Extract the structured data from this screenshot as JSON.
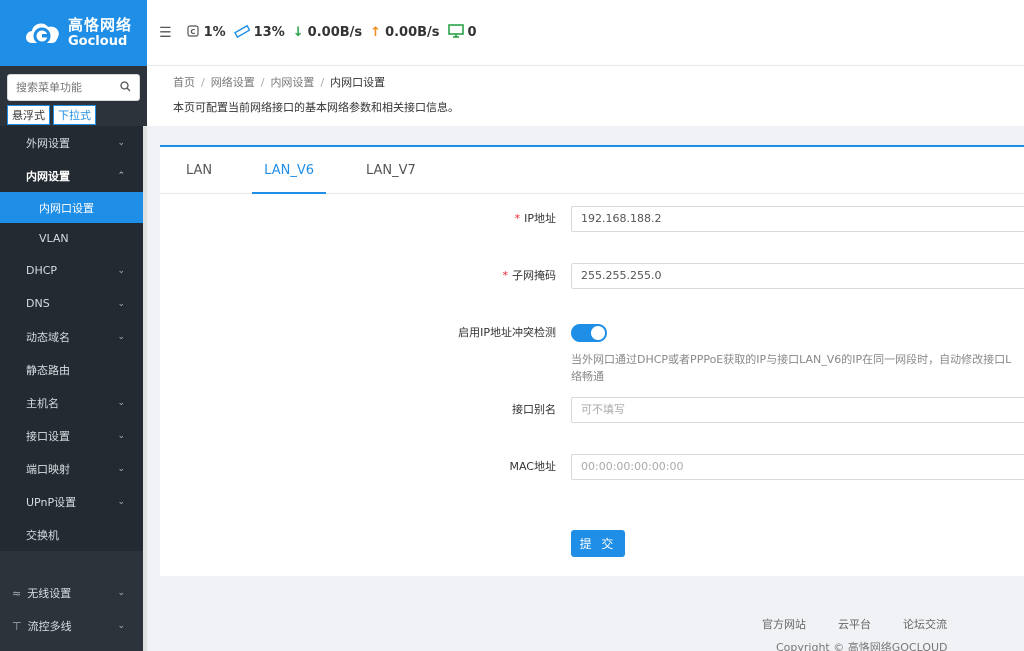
{
  "brand": {
    "name_cn": "高恪网络",
    "name_en": "Gocloud"
  },
  "topbar": {
    "cpu": "1%",
    "memory": "13%",
    "download": "0.00B/s",
    "upload": "0.00B/s",
    "devices": "0"
  },
  "sidebar": {
    "search_placeholder": "搜索菜单功能",
    "mode_buttons": [
      "悬浮式",
      "下拉式"
    ],
    "items": [
      {
        "label": "外网设置"
      },
      {
        "label": "内网设置"
      },
      {
        "label": "内网口设置"
      },
      {
        "label": "VLAN"
      },
      {
        "label": "DHCP"
      },
      {
        "label": "DNS"
      },
      {
        "label": "动态域名"
      },
      {
        "label": "静态路由"
      },
      {
        "label": "主机名"
      },
      {
        "label": "接口设置"
      },
      {
        "label": "端口映射"
      },
      {
        "label": "UPnP设置"
      },
      {
        "label": "交换机"
      }
    ],
    "bottom_items": [
      {
        "label": "无线设置"
      },
      {
        "label": "流控多线"
      }
    ]
  },
  "breadcrumb": [
    "首页",
    "网络设置",
    "内网设置",
    "内网口设置"
  ],
  "page_desc": "本页可配置当前网络接口的基本网络参数和相关接口信息。",
  "tabs": [
    "LAN",
    "LAN_V6",
    "LAN_V7"
  ],
  "form": {
    "ip_label": "IP地址",
    "ip_value": "192.168.188.2",
    "mask_label": "子网掩码",
    "mask_value": "255.255.255.0",
    "conflict_label": "启用IP地址冲突检测",
    "conflict_enabled": true,
    "conflict_hint_1": "当外网口通过DHCP或者PPPoE获取的IP与接口LAN_V6的IP在同一网段时，自动修改接口L",
    "conflict_hint_2": "络畅通",
    "alias_label": "接口别名",
    "alias_placeholder": "可不填写",
    "mac_label": "MAC地址",
    "mac_placeholder": "00:00:00:00:00:00",
    "submit_label": "提 交"
  },
  "footer": {
    "links": [
      "官方网站",
      "云平台",
      "论坛交流"
    ],
    "copyright": "Copyright © 高恪网络GOCLOUD"
  },
  "colors": {
    "accent": "#1f8ee6",
    "sidebar": "#2c333b"
  }
}
